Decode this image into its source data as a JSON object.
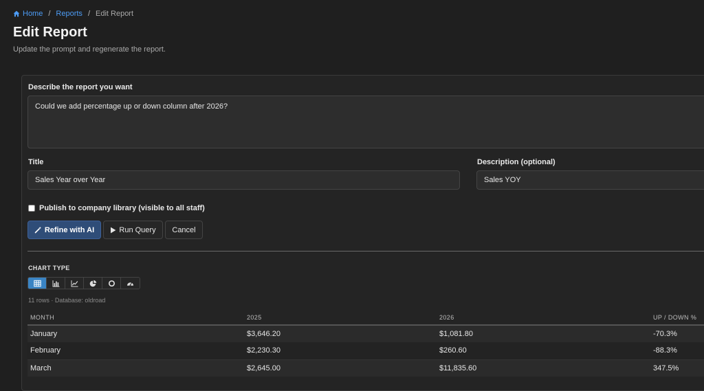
{
  "breadcrumb": {
    "home": "Home",
    "reports": "Reports",
    "current": "Edit Report"
  },
  "header": {
    "title": "Edit Report",
    "subtitle": "Update the prompt and regenerate the report."
  },
  "form": {
    "prompt_label": "Describe the report you want",
    "prompt_value": "Could we add percentage up or down column after 2026?",
    "title_label": "Title",
    "title_value": "Sales Year over Year",
    "description_label": "Description (optional)",
    "description_value": "Sales YOY",
    "publish_label": "Publish to company library (visible to all staff)",
    "publish_checked": false
  },
  "actions": {
    "refine_label": "Refine with AI",
    "run_label": "Run Query",
    "cancel_label": "Cancel"
  },
  "chart_type": {
    "label": "CHART TYPE",
    "options": [
      "table-icon",
      "bar-chart-icon",
      "line-chart-icon",
      "pie-chart-icon",
      "donut-chart-icon",
      "gauge-icon"
    ],
    "selected": "table-icon"
  },
  "results": {
    "meta": "11 rows · Database: oldroad",
    "columns": [
      "MONTH",
      "2025",
      "2026",
      "UP / DOWN %"
    ],
    "rows": [
      [
        "January",
        "$3,646.20",
        "$1,081.80",
        "-70.3%"
      ],
      [
        "February",
        "$2,230.30",
        "$260.60",
        "-88.3%"
      ],
      [
        "March",
        "$2,645.00",
        "$11,835.60",
        "347.5%"
      ]
    ]
  },
  "colors": {
    "accent": "#4d9cf5",
    "primary_button": "#2f4d78",
    "active_chart_type": "#3a84c4",
    "background": "#1f1f1f"
  }
}
